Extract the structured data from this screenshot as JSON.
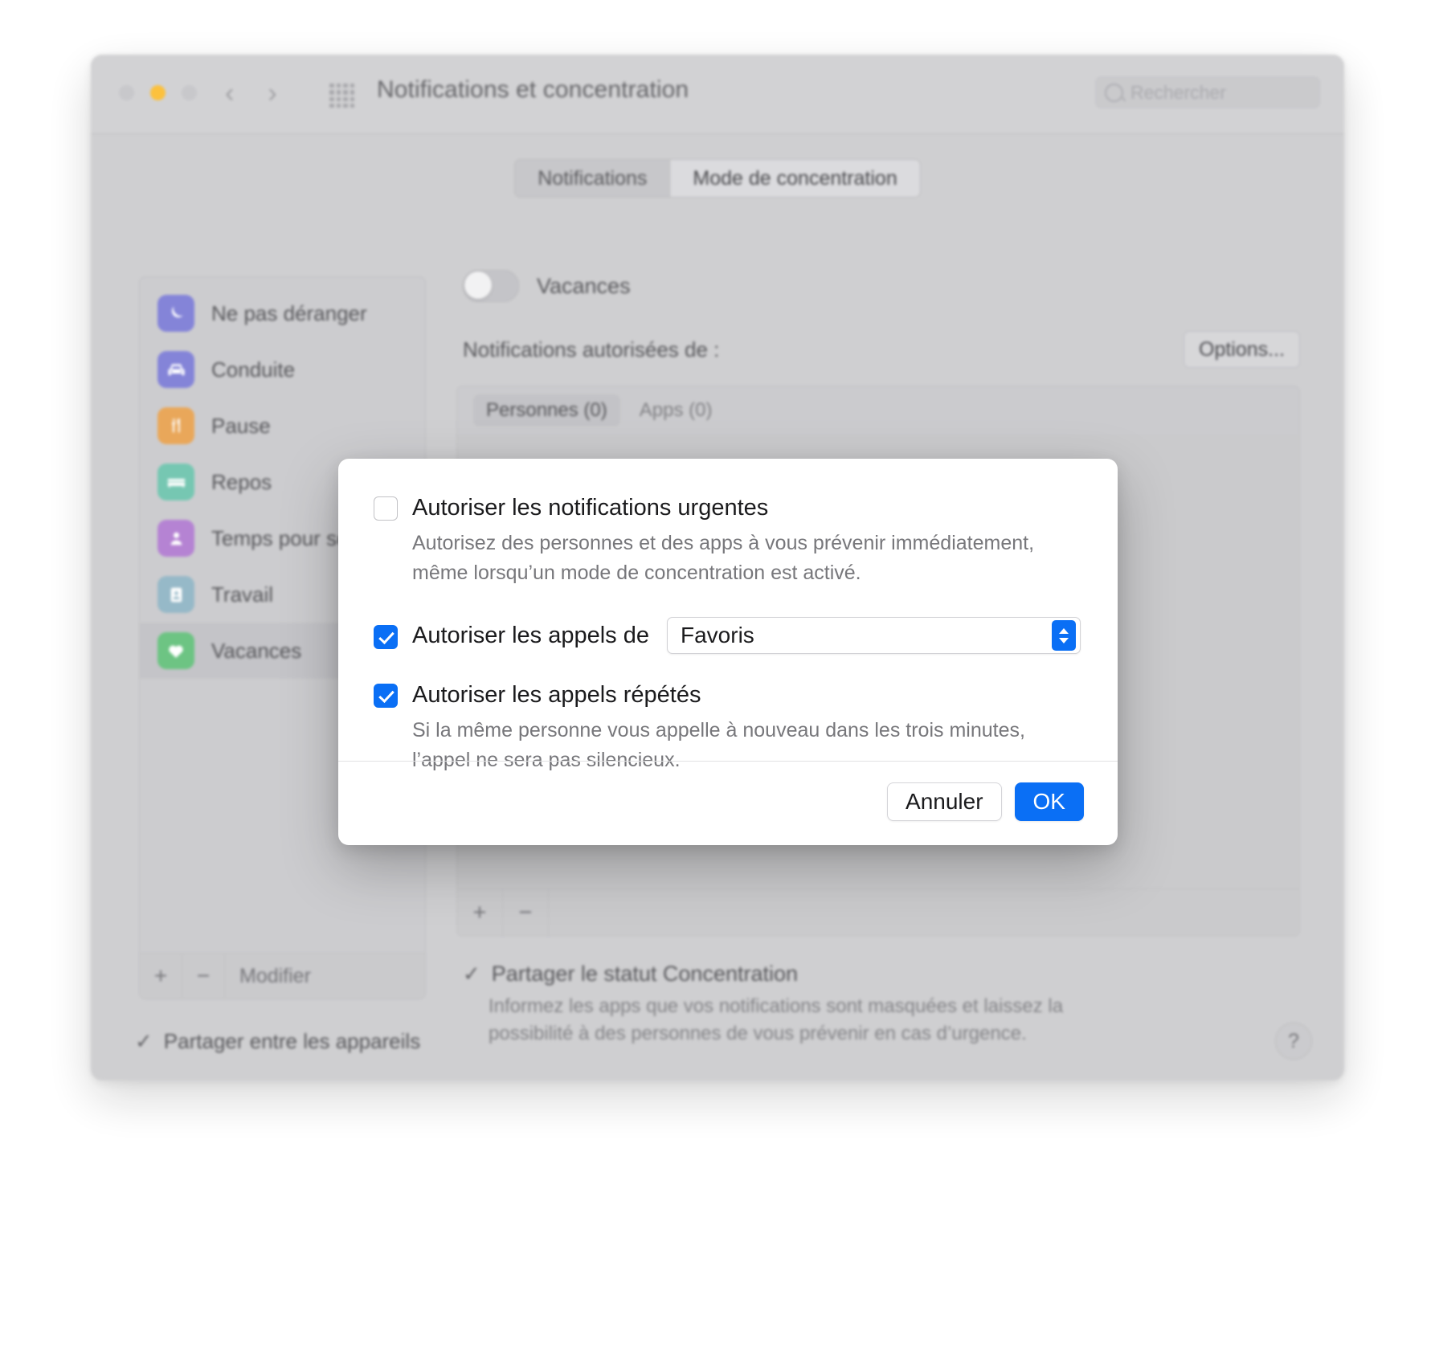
{
  "window": {
    "title": "Notifications et concentration",
    "traffic_lights": [
      "close",
      "minimize",
      "zoom"
    ],
    "nav": {
      "back": "‹",
      "forward": "›"
    },
    "grid_icon": "apps-grid-icon",
    "search": {
      "placeholder": "Rechercher",
      "value": ""
    }
  },
  "tabs": [
    {
      "label": "Notifications",
      "active": false
    },
    {
      "label": "Mode de concentration",
      "active": true
    }
  ],
  "sidebar": {
    "items": [
      {
        "label": "Ne pas déranger",
        "icon": "moon-icon",
        "color": "#7b7bd6",
        "selected": false
      },
      {
        "label": "Conduite",
        "icon": "car-icon",
        "color": "#7b7bd6",
        "selected": false
      },
      {
        "label": "Pause",
        "icon": "utensils-icon",
        "color": "#e8a champion",
        "selected": false
      },
      {
        "label": "Repos",
        "icon": "bed-icon",
        "color": "#6cc3ad",
        "selected": false
      },
      {
        "label": "Temps pour soi",
        "icon": "person-icon",
        "color": "#b07ad0",
        "selected": false
      },
      {
        "label": "Travail",
        "icon": "badge-icon",
        "color": "#8fb4c4",
        "selected": false
      },
      {
        "label": "Vacances",
        "icon": "heart-icon",
        "color": "#62c07a",
        "selected": true
      }
    ],
    "footer": {
      "add": "+",
      "remove": "−",
      "edit": "Modifier"
    }
  },
  "detail": {
    "focus_toggle": {
      "label": "Vacances",
      "enabled": false
    },
    "allowed_label": "Notifications autorisées de :",
    "options_button": "Options...",
    "list_tabs": [
      {
        "label": "Personnes (0)",
        "active": true
      },
      {
        "label": "Apps (0)",
        "active": false
      }
    ],
    "list_footer": {
      "add": "+",
      "remove": "−"
    },
    "share_status": {
      "checked": true,
      "check_glyph": "✓",
      "title": "Partager le statut Concentration",
      "description_line1": "Informez les apps que vos notifications sont masquées et laissez la",
      "description_line2": "possibilité à des personnes de vous prévenir en cas d’urgence."
    }
  },
  "window_footer": {
    "share_devices": {
      "checked": true,
      "check_glyph": "✓",
      "label": "Partager entre les appareils"
    },
    "help": "?"
  },
  "sheet": {
    "urgent": {
      "checked": false,
      "label": "Autoriser les notifications urgentes",
      "description_line1": "Autorisez des personnes et des apps à vous prévenir immédiatement,",
      "description_line2": "même lorsqu’un mode de concentration est activé."
    },
    "calls_from": {
      "checked": true,
      "label": "Autoriser les appels de",
      "value": "Favoris"
    },
    "repeated_calls": {
      "checked": true,
      "label": "Autoriser les appels répétés",
      "description_line1": "Si la même personne vous appelle à nouveau dans les trois minutes,",
      "description_line2": "l’appel ne sera pas silencieux."
    },
    "buttons": {
      "cancel": "Annuler",
      "ok": "OK"
    }
  },
  "colors": {
    "accent_blue": "#0a6ff5",
    "window_bg": "#ccccce",
    "sheet_bg": "#ffffff"
  }
}
